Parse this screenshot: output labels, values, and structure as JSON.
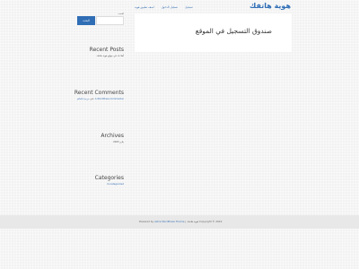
{
  "header": {
    "site_title": "هوية هاتفك",
    "nav": [
      "تسجيل",
      "تسجيل الدخول",
      "اضف تطبيق هوية"
    ]
  },
  "post": {
    "title": "صندوق التسجيل في الموقع"
  },
  "sidebar": {
    "search": {
      "label": "البحث",
      "button": "البحث",
      "value": ""
    },
    "recent_posts": {
      "title": "Recent Posts",
      "items": [
        "أهلا بك في موقع هوية هاتفك"
      ]
    },
    "recent_comments": {
      "title": "Recent Comments",
      "items": [
        "A WordPress Commenter",
        "على",
        "مرحبا بالعالم"
      ]
    },
    "archives": {
      "title": "Archives",
      "items": [
        "يناير 2023"
      ]
    },
    "categories": {
      "title": "Categories",
      "items": [
        "Uncategorized"
      ]
    }
  },
  "footer": {
    "copyright": "Copyright © 2022 هوية هاتفك | Powered by",
    "theme_link": "Astra WordPress Theme"
  },
  "colors": {
    "accent": "#2f6db5",
    "background": "#f2f2f2",
    "footer": "#e8e8e8"
  }
}
